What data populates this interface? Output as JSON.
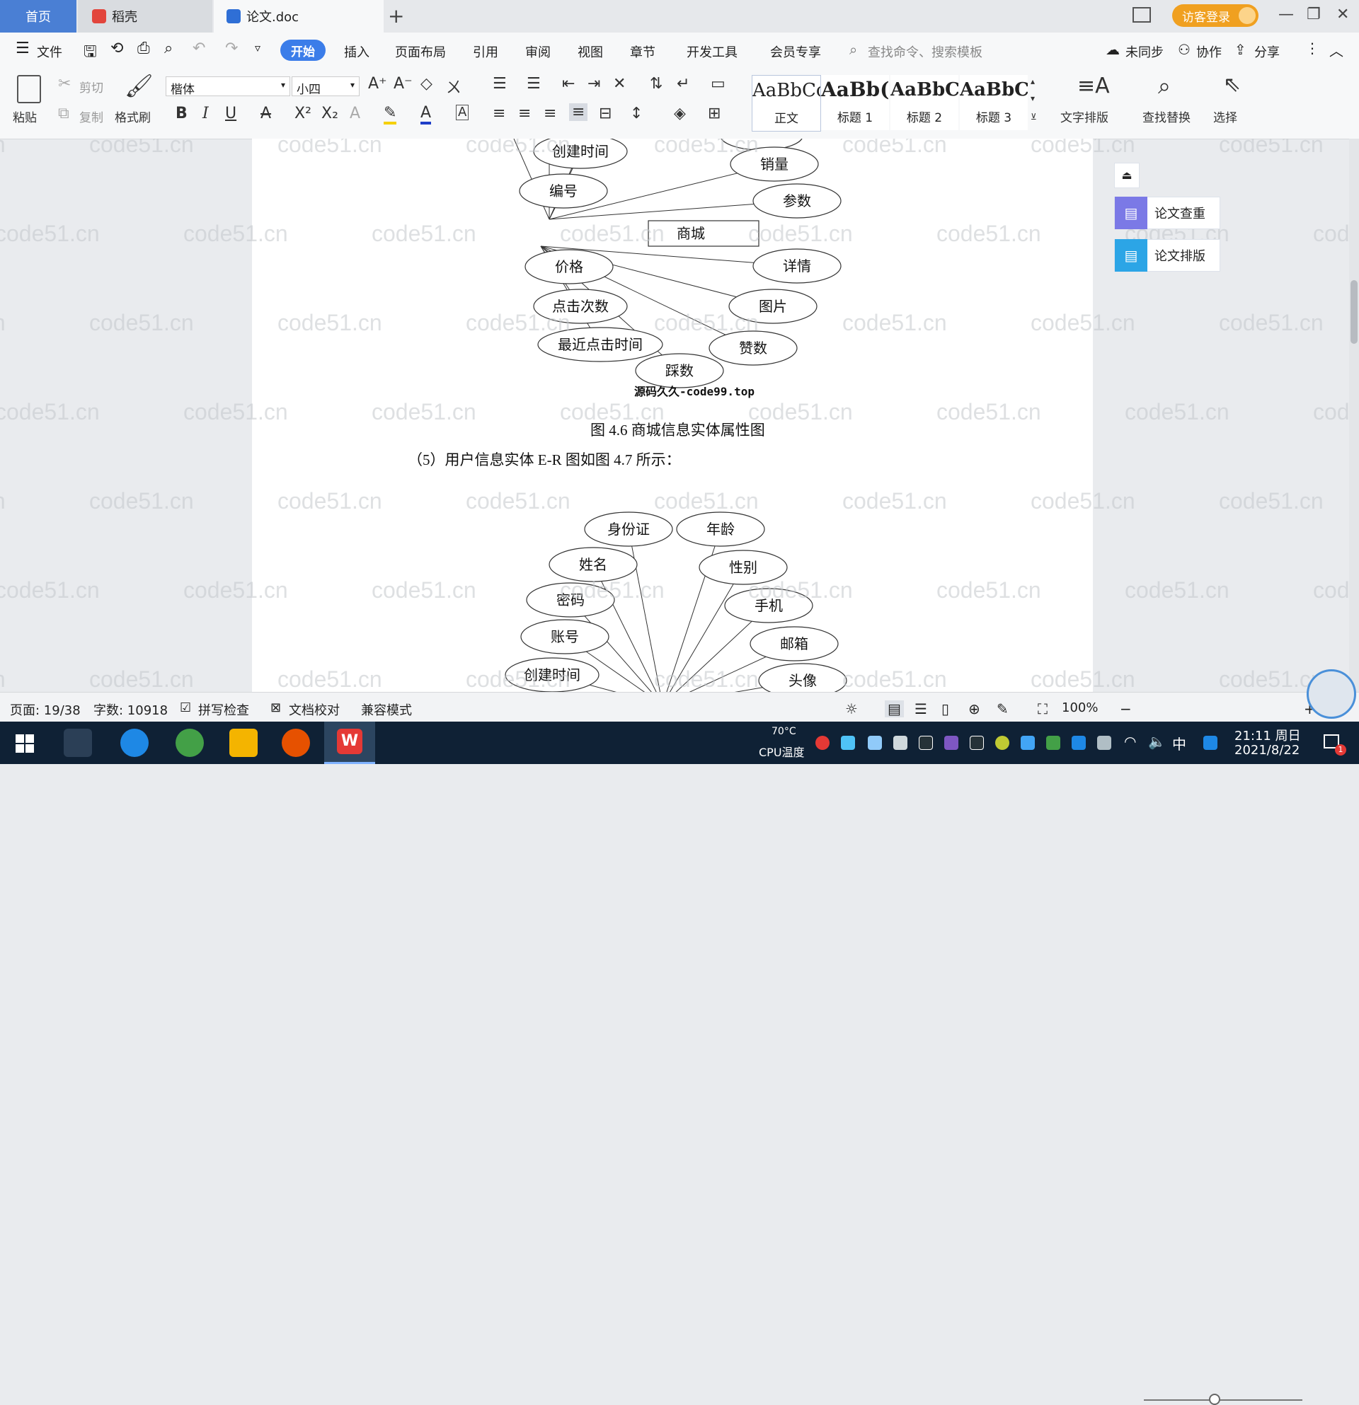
{
  "tabs": {
    "home": "首页",
    "docer": "稻壳",
    "doc": "论文.doc",
    "add": "+"
  },
  "header": {
    "guest_login": "访客登录"
  },
  "menu": {
    "file": "文件",
    "items": [
      "开始",
      "插入",
      "页面布局",
      "引用",
      "审阅",
      "视图",
      "章节",
      "开发工具",
      "会员专享"
    ],
    "search": "查找命令、搜索模板",
    "unsynced": "未同步",
    "collab": "协作",
    "share": "分享"
  },
  "ribbon": {
    "paste": "粘贴",
    "cut": "剪切",
    "copy": "复制",
    "format_painter": "格式刷",
    "font_name": "楷体",
    "font_size": "小四",
    "styles": [
      {
        "preview": "AaBbCcI",
        "name": "正文"
      },
      {
        "preview": "AaBb(",
        "name": "标题 1"
      },
      {
        "preview": "AaBbC",
        "name": "标题 2"
      },
      {
        "preview": "AaBbC",
        "name": "标题 3"
      }
    ],
    "text_layout": "文字排版",
    "find_replace": "查找替换",
    "select": "选择"
  },
  "side_panel": {
    "check": "论文查重",
    "format": "论文排版"
  },
  "document": {
    "diagram1": {
      "center": "商城",
      "attributes": [
        "创建时间",
        "销量",
        "编号",
        "参数",
        "价格",
        "详情",
        "点击次数",
        "图片",
        "最近点击时间",
        "赞数",
        "踩数"
      ],
      "source": "源码久久-code99.top"
    },
    "caption1": "图 4.6  商城信息实体属性图",
    "paragraph": "（5）用户信息实体 E-R 图如图 4.7 所示：",
    "diagram2": {
      "attributes": [
        "身份证",
        "年龄",
        "姓名",
        "性别",
        "密码",
        "手机",
        "账号",
        "邮箱",
        "创建时间",
        "头像"
      ]
    },
    "watermark": "code51.cn"
  },
  "status": {
    "page": "页面: 19/38",
    "words": "字数: 10918",
    "spell": "拼写检查",
    "proof": "文档校对",
    "compat": "兼容模式",
    "zoom": "100%"
  },
  "taskbar": {
    "cpu_temp": "70°C",
    "cpu_label": "CPU温度",
    "ime": "中",
    "time": "21:11 周日",
    "date": "2021/8/22",
    "notif": "1"
  },
  "colors": {
    "accent": "#3b7de9",
    "guest": "#f0a020",
    "taskbar": "#0f2135"
  }
}
